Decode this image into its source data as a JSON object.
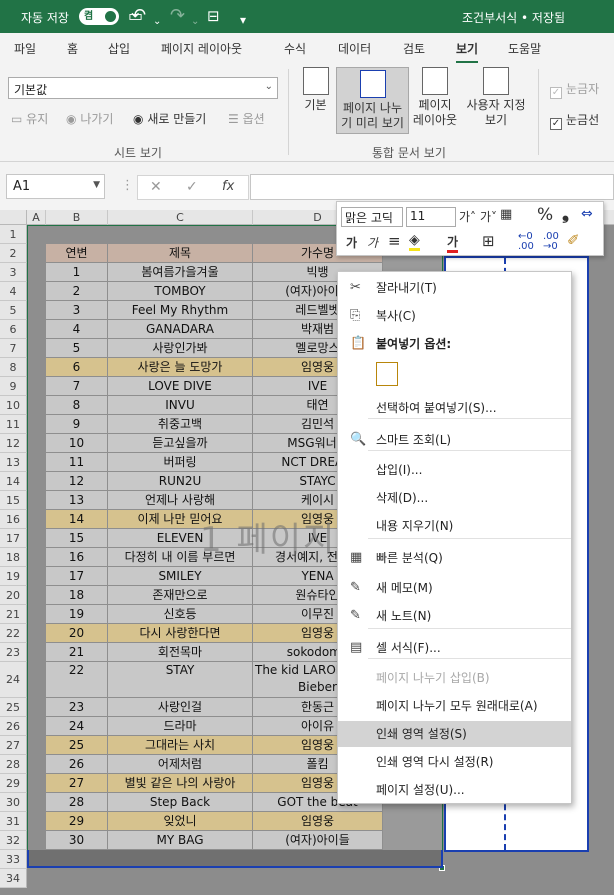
{
  "titlebar": {
    "autosave_label": "자동 저장",
    "autosave_state": "켬",
    "filename": "조건부서식 • 저장됨",
    "save_icon": "save-icon"
  },
  "tabs": [
    "파일",
    "홈",
    "삽입",
    "페이지 레이아웃",
    "수식",
    "데이터",
    "검토",
    "보기",
    "도움말"
  ],
  "active_tab": "보기",
  "ribbon": {
    "sheet_view_value": "기본값",
    "keep_label": "유지",
    "exit_label": "나가기",
    "new_label": "새로 만들기",
    "options_label": "옵션",
    "sheet_view_group": "시트 보기",
    "normal_label": "기본",
    "page_break_label_1": "페이지 나누",
    "page_break_label_2": "기 미리 보기",
    "page_layout_label_1": "페이지",
    "page_layout_label_2": "레이아웃",
    "custom_view_label_1": "사용자 지정",
    "custom_view_label_2": "보기",
    "workbook_views_group": "통합 문서 보기",
    "ruler_label": "눈금자",
    "gridlines_label": "눈금선"
  },
  "formula_bar": {
    "name_box": "A1",
    "cancel": "✕",
    "enter": "✓",
    "fx": "fx"
  },
  "columns": [
    "A",
    "B",
    "C",
    "D"
  ],
  "watermark": "1 페이지",
  "table_header": {
    "no": "연변",
    "title": "제목",
    "artist": "가수명"
  },
  "rows": [
    {
      "no": "1",
      "title": "봄여름가을겨울",
      "artist": "빅뱅",
      "hl": false
    },
    {
      "no": "2",
      "title": "TOMBOY",
      "artist": "(여자)아이들",
      "hl": false
    },
    {
      "no": "3",
      "title": "Feel My Rhythm",
      "artist": "레드벨벳",
      "hl": false
    },
    {
      "no": "4",
      "title": "GANADARA",
      "artist": "박재범",
      "hl": false
    },
    {
      "no": "5",
      "title": "사랑인가봐",
      "artist": "멜로망스",
      "hl": false
    },
    {
      "no": "6",
      "title": "사랑은 늘 도망가",
      "artist": "임영웅",
      "hl": true
    },
    {
      "no": "7",
      "title": "LOVE DIVE",
      "artist": "IVE",
      "hl": false
    },
    {
      "no": "8",
      "title": "INVU",
      "artist": "태연",
      "hl": false
    },
    {
      "no": "9",
      "title": "취중고백",
      "artist": "김민석",
      "hl": false
    },
    {
      "no": "10",
      "title": "듣고싶을까",
      "artist": "MSG워너비",
      "hl": false
    },
    {
      "no": "11",
      "title": "버퍼링",
      "artist": "NCT DREAM",
      "hl": false
    },
    {
      "no": "12",
      "title": "RUN2U",
      "artist": "STAYC",
      "hl": false
    },
    {
      "no": "13",
      "title": "언제나 사랑해",
      "artist": "케이시",
      "hl": false
    },
    {
      "no": "14",
      "title": "이제 나만 믿어요",
      "artist": "임영웅",
      "hl": true
    },
    {
      "no": "15",
      "title": "ELEVEN",
      "artist": "IVE",
      "hl": false
    },
    {
      "no": "16",
      "title": "다정히 내 이름 부르면",
      "artist": "경서예지, 전건호",
      "hl": false
    },
    {
      "no": "17",
      "title": "SMILEY",
      "artist": "YENA",
      "hl": false
    },
    {
      "no": "18",
      "title": "존재만으로",
      "artist": "원슈타인",
      "hl": false
    },
    {
      "no": "19",
      "title": "신호등",
      "artist": "이무진",
      "hl": false
    },
    {
      "no": "20",
      "title": "다시 사랑한다면",
      "artist": "임영웅",
      "hl": true
    },
    {
      "no": "21",
      "title": "회전목마",
      "artist": "sokodomo",
      "hl": false
    },
    {
      "no": "22",
      "title": "STAY",
      "artist": "The kid LAROI, Justin Bieber",
      "hl": false
    },
    {
      "no": "23",
      "title": "사랑인걸",
      "artist": "한동근",
      "hl": false
    },
    {
      "no": "24",
      "title": "드라마",
      "artist": "아이유",
      "hl": false
    },
    {
      "no": "25",
      "title": "그대라는 사치",
      "artist": "임영웅",
      "hl": true
    },
    {
      "no": "26",
      "title": "어제처럼",
      "artist": "폴킴",
      "hl": false
    },
    {
      "no": "27",
      "title": "별빛 같은 나의 사랑아",
      "artist": "임영웅",
      "hl": true
    },
    {
      "no": "28",
      "title": "Step Back",
      "artist": "GOT the beat",
      "hl": false
    },
    {
      "no": "29",
      "title": "잊었니",
      "artist": "임영웅",
      "hl": true
    },
    {
      "no": "30",
      "title": "MY BAG",
      "artist": "(여자)아이들",
      "hl": false
    }
  ],
  "row_numbers": [
    "1",
    "2",
    "3",
    "4",
    "5",
    "6",
    "7",
    "8",
    "9",
    "10",
    "11",
    "12",
    "13",
    "14",
    "15",
    "16",
    "17",
    "18",
    "19",
    "20",
    "21",
    "22",
    "23",
    "24",
    "25",
    "26",
    "27",
    "28",
    "29",
    "30",
    "31",
    "32",
    "33",
    "34"
  ],
  "mini_toolbar": {
    "font": "맑은 고딕",
    "size": "11",
    "grow": "가˄",
    "shrink": "가˅",
    "percent": "%",
    "comma": "❟",
    "bold": "가",
    "italic": "가",
    "align": "≡",
    "fontcolor": "가",
    "dec_inc": "←.0\n.00",
    "dec_dec": ".00\n→.0"
  },
  "context_menu": [
    {
      "label": "잘라내기(T)",
      "icon": "cut-icon",
      "glyph": "✂",
      "disabled": false,
      "hover": false
    },
    {
      "label": "복사(C)",
      "icon": "copy-icon",
      "glyph": "⎘",
      "disabled": false,
      "hover": false
    },
    {
      "label": "붙여넣기 옵션:",
      "icon": "paste-icon",
      "glyph": "📋",
      "disabled": false,
      "hover": false,
      "bold": true
    },
    {
      "label": "선택하여 붙여넣기(S)...",
      "icon": "",
      "glyph": "",
      "disabled": false,
      "hover": false
    },
    {
      "label": "스마트 조회(L)",
      "icon": "smart-lookup-icon",
      "glyph": "🔍",
      "disabled": false,
      "hover": false
    },
    {
      "label": "삽입(I)...",
      "icon": "",
      "glyph": "",
      "disabled": false,
      "hover": false
    },
    {
      "label": "삭제(D)...",
      "icon": "",
      "glyph": "",
      "disabled": false,
      "hover": false
    },
    {
      "label": "내용 지우기(N)",
      "icon": "",
      "glyph": "",
      "disabled": false,
      "hover": false
    },
    {
      "label": "빠른 분석(Q)",
      "icon": "quick-analysis-icon",
      "glyph": "▦",
      "disabled": false,
      "hover": false
    },
    {
      "label": "새 메모(M)",
      "icon": "new-comment-icon",
      "glyph": "✎",
      "disabled": false,
      "hover": false
    },
    {
      "label": "새 노트(N)",
      "icon": "new-note-icon",
      "glyph": "✎",
      "disabled": false,
      "hover": false
    },
    {
      "label": "셀 서식(F)...",
      "icon": "format-cells-icon",
      "glyph": "▤",
      "disabled": false,
      "hover": false
    },
    {
      "label": "페이지 나누기 삽입(B)",
      "icon": "",
      "glyph": "",
      "disabled": true,
      "hover": false
    },
    {
      "label": "페이지 나누기 모두 원래대로(A)",
      "icon": "",
      "glyph": "",
      "disabled": false,
      "hover": false
    },
    {
      "label": "인쇄 영역 설정(S)",
      "icon": "",
      "glyph": "",
      "disabled": false,
      "hover": true
    },
    {
      "label": "인쇄 영역 다시 설정(R)",
      "icon": "",
      "glyph": "",
      "disabled": false,
      "hover": false
    },
    {
      "label": "페이지 설정(U)...",
      "icon": "",
      "glyph": "",
      "disabled": false,
      "hover": false
    }
  ]
}
